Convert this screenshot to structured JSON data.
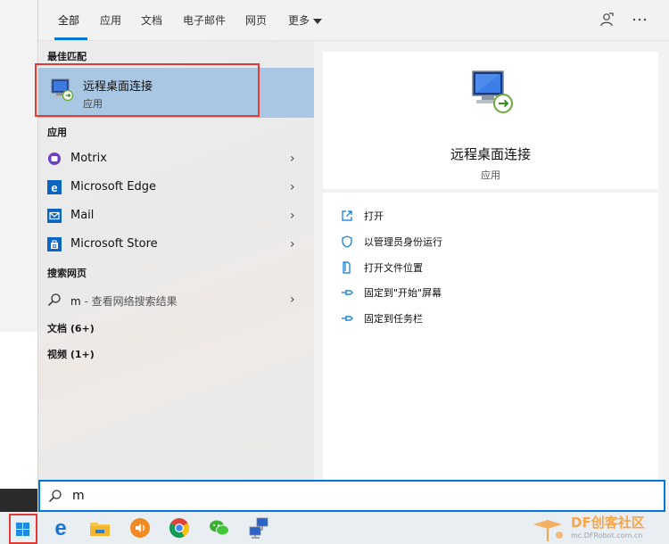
{
  "tabs": [
    {
      "label": "全部",
      "active": true
    },
    {
      "label": "应用"
    },
    {
      "label": "文档"
    },
    {
      "label": "电子邮件"
    },
    {
      "label": "网页"
    },
    {
      "label": "更多"
    }
  ],
  "top_icons": [
    "feedback-icon",
    "more-options-icon"
  ],
  "best_match": {
    "heading": "最佳匹配",
    "title": "远程桌面连接",
    "subtitle": "应用",
    "icon": "remote-desktop-icon"
  },
  "apps": {
    "heading": "应用",
    "items": [
      {
        "label": "Motrix",
        "icon": "motrix-icon"
      },
      {
        "label": "Microsoft Edge",
        "icon": "edge-icon"
      },
      {
        "label": "Mail",
        "icon": "mail-icon"
      },
      {
        "label": "Microsoft Store",
        "icon": "store-icon"
      }
    ]
  },
  "web_search": {
    "heading": "搜索网页",
    "query": "m",
    "suffix": " - 查看网络搜索结果"
  },
  "categories": [
    {
      "label": "文档 (6+)"
    },
    {
      "label": "视频 (1+)"
    }
  ],
  "detail": {
    "title": "远程桌面连接",
    "subtitle": "应用",
    "actions": [
      {
        "label": "打开",
        "icon": "open-icon"
      },
      {
        "label": "以管理员身份运行",
        "icon": "shield-icon"
      },
      {
        "label": "打开文件位置",
        "icon": "folder-location-icon"
      },
      {
        "label": "固定到\"开始\"屏幕",
        "icon": "pin-start-icon"
      },
      {
        "label": "固定到任务栏",
        "icon": "pin-taskbar-icon"
      }
    ]
  },
  "search_box": {
    "value": "m"
  },
  "taskbar": {
    "items": [
      "windows-start-icon",
      "edge-icon",
      "file-explorer-icon",
      "audio-app-icon",
      "chrome-icon",
      "wechat-icon",
      "network-app-icon"
    ]
  },
  "watermark": {
    "main": "DF创客社区",
    "sub": "mc.DFRobot.com.cn"
  },
  "colors": {
    "accent": "#0078d7",
    "selection": "#a9c7e3",
    "highlight_outline": "#e53935"
  }
}
